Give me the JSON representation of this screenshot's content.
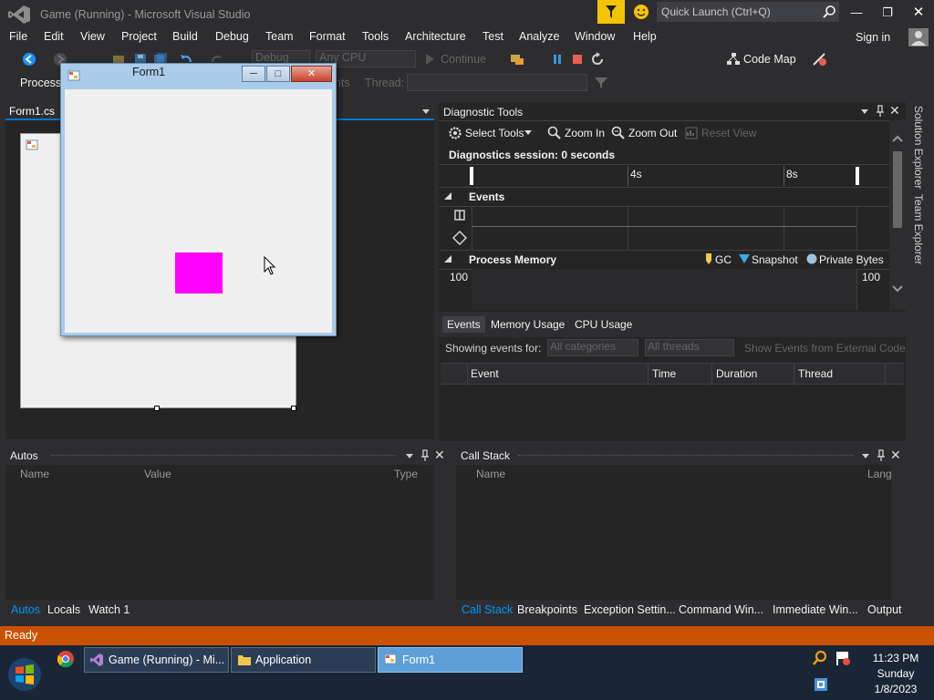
{
  "app": {
    "title": "Game (Running) - Microsoft Visual Studio",
    "quick_launch_placeholder": "Quick Launch (Ctrl+Q)",
    "sign_in": "Sign in"
  },
  "menu": [
    "File",
    "Edit",
    "View",
    "Project",
    "Build",
    "Debug",
    "Team",
    "Format",
    "Tools",
    "Architecture",
    "Test",
    "Analyze",
    "Window",
    "Help"
  ],
  "toolbar": {
    "config": "Debug",
    "platform": "Any CPU",
    "continue": "Continue",
    "code_map": "Code Map",
    "process_label": "Process:",
    "thread_label": "Thread:",
    "process_hidden_tail": "nts"
  },
  "document": {
    "tab": "Form1.cs"
  },
  "form1": {
    "title": "Form1",
    "box_color": "#ff00ff"
  },
  "diagnostics": {
    "title": "Diagnostic Tools",
    "select_tools": "Select Tools",
    "zoom_in": "Zoom In",
    "zoom_out": "Zoom Out",
    "reset_view": "Reset View",
    "session": "Diagnostics session: 0 seconds",
    "tick_4s": "4s",
    "tick_8s": "8s",
    "events_header": "Events",
    "memory_header": "Process Memory",
    "legend_gc": "GC",
    "legend_snapshot": "Snapshot",
    "legend_private": "Private Bytes",
    "mem_left": "100",
    "mem_right": "100",
    "tabs": [
      "Events",
      "Memory Usage",
      "CPU Usage"
    ],
    "showing_events_for": "Showing events for:",
    "all_categories": "All categories",
    "all_threads": "All threads",
    "external_code": "Show Events from External Code",
    "columns": [
      "Event",
      "Time",
      "Duration",
      "Thread"
    ]
  },
  "sidebar": {
    "solution_explorer": "Solution Explorer",
    "team_explorer": "Team Explorer"
  },
  "autos": {
    "title": "Autos",
    "columns": [
      "Name",
      "Value",
      "Type"
    ],
    "tabs": [
      "Autos",
      "Locals",
      "Watch 1"
    ]
  },
  "callstack": {
    "title": "Call Stack",
    "columns": [
      "Name",
      "Lang"
    ],
    "tabs": [
      "Call Stack",
      "Breakpoints",
      "Exception Settin...",
      "Command Win...",
      "Immediate Win...",
      "Output"
    ]
  },
  "status": {
    "text": "Ready"
  },
  "taskbar": {
    "items": [
      "Game (Running) - Mi...",
      "Application",
      "Form1"
    ],
    "time": "11:23 PM",
    "day": "Sunday",
    "date": "1/8/2023"
  }
}
